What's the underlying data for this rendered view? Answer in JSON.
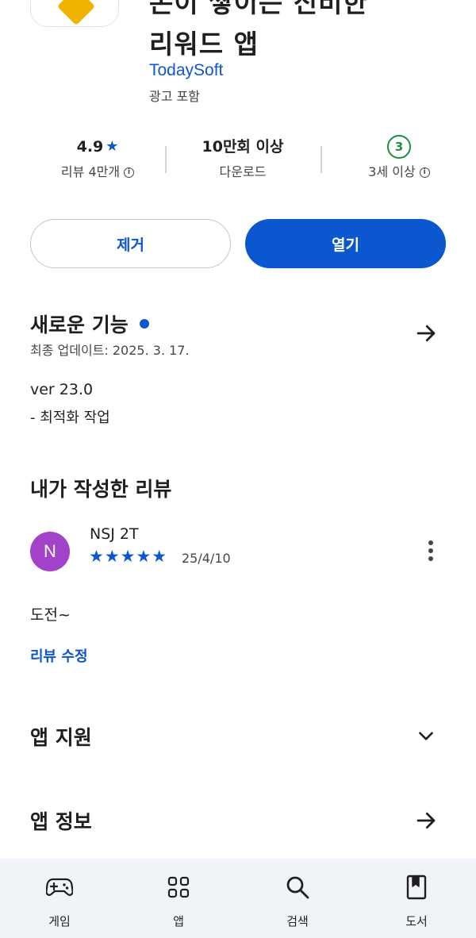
{
  "app": {
    "title_line1": "돈이 쌓이는 신비한",
    "title_line2": "리워드 앱",
    "developer": "TodaySoft",
    "ads": "광고 포함"
  },
  "stats": {
    "rating": "4.9",
    "reviews": "리뷰 4만개",
    "downloads": "10만회 이상",
    "downloads_label": "다운로드",
    "age_badge": "3",
    "age_label": "3세 이상"
  },
  "buttons": {
    "uninstall": "제거",
    "open": "열기"
  },
  "whats_new": {
    "title": "새로운 기능",
    "updated": "최종 업데이트: 2025. 3. 17.",
    "version": "ver 23.0",
    "notes": "- 최적화 작업"
  },
  "my_review": {
    "title": "내가 작성한 리뷰",
    "avatar_letter": "N",
    "name": "NSJ 2T",
    "stars": 5,
    "stars_text": "★★★★★",
    "date": "25/4/10",
    "text": "도전~",
    "edit": "리뷰 수정"
  },
  "sections": {
    "support": "앱 지원",
    "info": "앱 정보"
  },
  "nav": [
    {
      "label": "게임",
      "icon": "gamepad-icon"
    },
    {
      "label": "앱",
      "icon": "apps-grid-icon"
    },
    {
      "label": "검색",
      "icon": "search-icon"
    },
    {
      "label": "도서",
      "icon": "book-icon"
    }
  ],
  "colors": {
    "accent": "#0b57d0",
    "avatar": "#a142c8",
    "age_green": "#1e8e3e"
  }
}
